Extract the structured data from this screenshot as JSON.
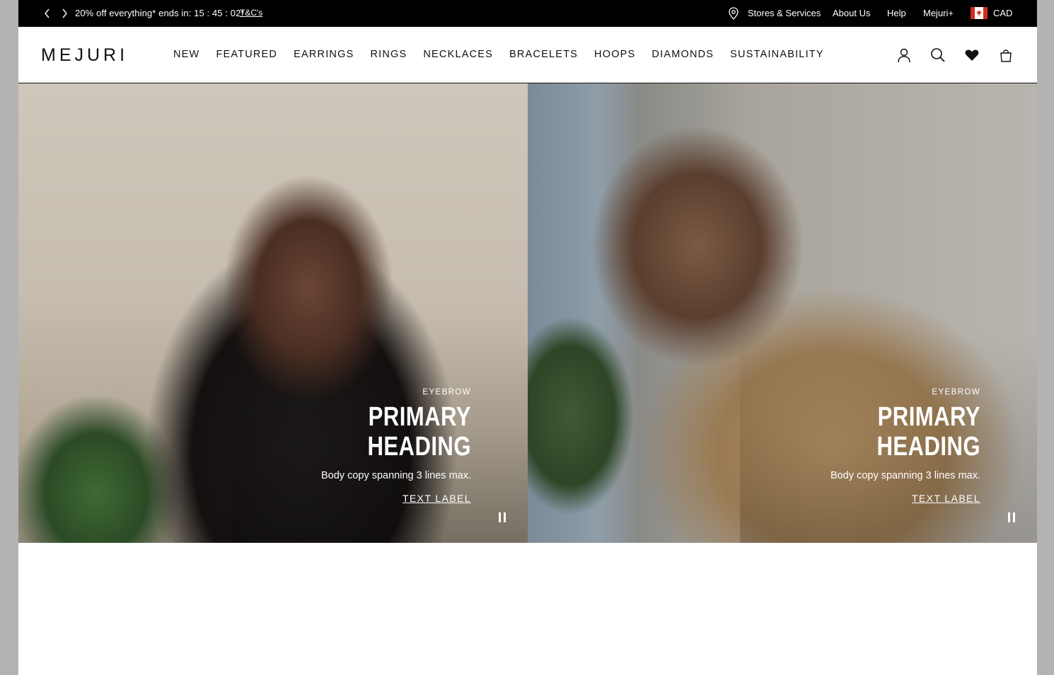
{
  "announcement": {
    "promo_text": "20% off everything* ends in: 15 : 45 : 02*",
    "terms_link": "T&C's",
    "utility_links": {
      "stores": "Stores & Services",
      "about": "About Us",
      "help": "Help",
      "mejuri_plus": "Mejuri+",
      "currency": "CAD"
    }
  },
  "header": {
    "logo": "MEJURI",
    "nav": [
      "NEW",
      "FEATURED",
      "EARRINGS",
      "RINGS",
      "NECKLACES",
      "BRACELETS",
      "HOOPS",
      "DIAMONDS",
      "SUSTAINABILITY"
    ]
  },
  "hero": {
    "panels": [
      {
        "eyebrow": "EYEBROW",
        "heading": "PRIMARY HEADING",
        "body": "Body copy spanning 3 lines max.",
        "link": "TEXT LABEL"
      },
      {
        "eyebrow": "EYEBROW",
        "heading": "PRIMARY HEADING",
        "body": "Body copy spanning 3 lines max.",
        "link": "TEXT LABEL"
      }
    ]
  },
  "icons": {
    "prev": "chevron-left-icon",
    "next": "chevron-right-icon",
    "location": "location-pin-icon",
    "flag": "canada-flag-icon",
    "account": "user-icon",
    "search": "search-icon",
    "wishlist": "heart-icon",
    "bag": "shopping-bag-icon",
    "pause": "pause-icon"
  },
  "colors": {
    "announcement_bg": "#000000",
    "text_dark": "#111111",
    "hero_text": "#ffffff"
  }
}
